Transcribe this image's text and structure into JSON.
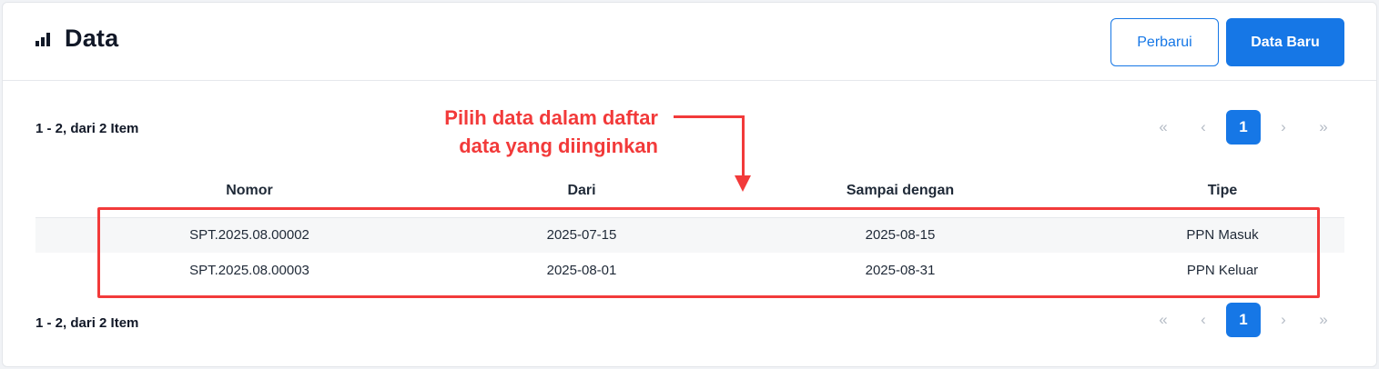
{
  "header": {
    "icon": "bar-chart-icon",
    "title": "Data",
    "refresh_label": "Perbarui",
    "new_label": "Data Baru"
  },
  "pagination": {
    "summary": "1 - 2, dari 2 Item",
    "first": "«",
    "prev": "‹",
    "current": "1",
    "next": "›",
    "last": "»"
  },
  "annotation": {
    "line1": "Pilih data dalam daftar",
    "line2": "data yang diinginkan",
    "color": "#f23a3a"
  },
  "table": {
    "columns": [
      "Nomor",
      "Dari",
      "Sampai dengan",
      "Tipe"
    ],
    "rows": [
      [
        "SPT.2025.08.00002",
        "2025-07-15",
        "2025-08-15",
        "PPN Masuk"
      ],
      [
        "SPT.2025.08.00003",
        "2025-08-01",
        "2025-08-31",
        "PPN Keluar"
      ]
    ]
  },
  "colors": {
    "primary": "#1677e6",
    "text": "#1f2937"
  }
}
